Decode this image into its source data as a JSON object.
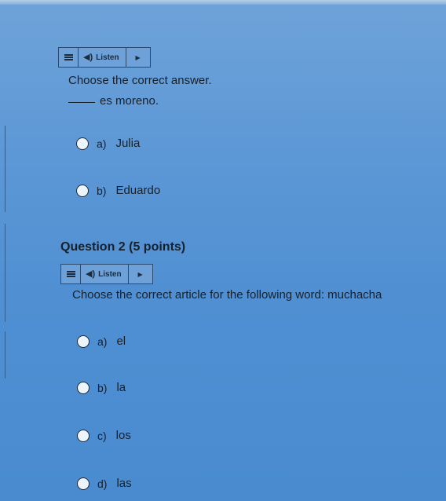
{
  "question1": {
    "listen_bar": {
      "label": "Listen"
    },
    "prompt": "Choose the correct answer.",
    "sentence": "es moreno.",
    "options": [
      {
        "letter": "a)",
        "text": "Julia"
      },
      {
        "letter": "b)",
        "text": "Eduardo"
      }
    ]
  },
  "question2": {
    "title": "Question 2 (5 points)",
    "listen_bar": {
      "label": "Listen"
    },
    "prompt": "Choose the correct article for the following word:  muchacha",
    "options": [
      {
        "letter": "a)",
        "text": "el"
      },
      {
        "letter": "b)",
        "text": "la"
      },
      {
        "letter": "c)",
        "text": "los"
      },
      {
        "letter": "d)",
        "text": "las"
      }
    ]
  }
}
